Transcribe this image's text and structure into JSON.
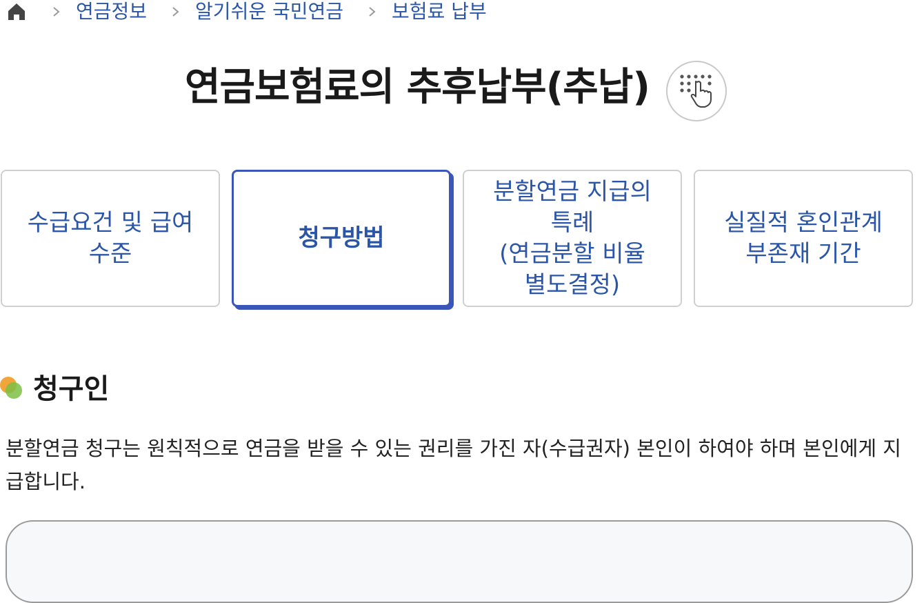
{
  "breadcrumb": {
    "home_icon": "home-icon",
    "separator_icon": "chevron-right-icon",
    "items": [
      "연금정보",
      "알기쉬운 국민연금",
      "보험료 납부"
    ]
  },
  "title": {
    "text": "연금보험료의 추후납부(추납)",
    "braille_icon": "braille-hand-icon"
  },
  "tabs": [
    {
      "label": "수급요건 및 급여\n수준",
      "active": false
    },
    {
      "label": "청구방법",
      "active": true
    },
    {
      "label": "분할연금 지급의\n특례\n(연금분할 비율\n별도결정)",
      "active": false
    },
    {
      "label": "실질적 혼인관계\n부존재 기간",
      "active": false
    }
  ],
  "section": {
    "title": "청구인",
    "body": "분할연금 청구는 원칙적으로 연금을 받을 수 있는 권리를 가진 자(수급권자) 본인이 하여야 하며 본인에게 지급합니다."
  },
  "colors": {
    "link_blue": "#2b56a8",
    "active_border": "#3a56b8",
    "bullet_orange": "#f0a030",
    "bullet_green": "#7cc044"
  }
}
